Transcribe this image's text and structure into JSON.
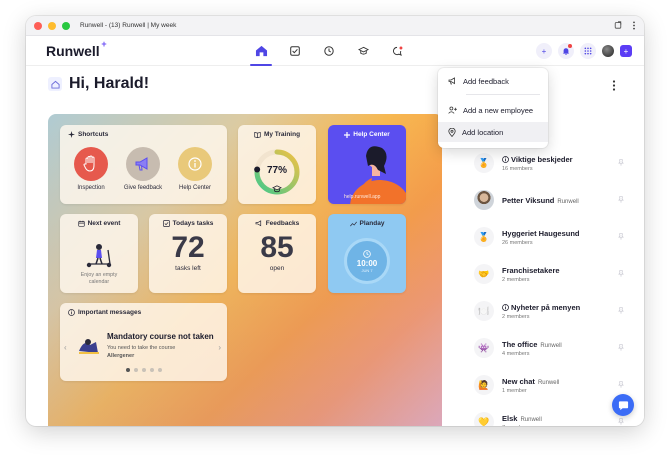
{
  "window": {
    "title": "Runwell - (13) Runwell | My week"
  },
  "app": {
    "logo": "Runwell",
    "logo_spark": "+",
    "plus_glyph": "+"
  },
  "greeting": "Hi, Harald!",
  "shortcuts": {
    "title": "Shortcuts",
    "items": [
      {
        "label": "Inspection",
        "icon": "stop-hand-icon"
      },
      {
        "label": "Give feedback",
        "icon": "megaphone-icon"
      },
      {
        "label": "Help Center",
        "icon": "info-icon"
      }
    ]
  },
  "my_training": {
    "title": "My Training",
    "percent_label": "77%",
    "progress": 0.77
  },
  "help_center": {
    "title": "Help Center",
    "url": "help.runwell.app"
  },
  "next_event": {
    "title": "Next event",
    "empty_text": "Enjoy an empty calendar"
  },
  "todays_tasks": {
    "title": "Todays tasks",
    "count": "72",
    "sub": "tasks left"
  },
  "feedbacks": {
    "title": "Feedbacks",
    "count": "85",
    "sub": "open"
  },
  "planday": {
    "title": "Planday",
    "time": "10:00",
    "date": "JUN 7"
  },
  "important_messages": {
    "title": "Important messages",
    "headline": "Mandatory course not taken",
    "body": "You need to take the course",
    "course": "Allergener",
    "dots": 5,
    "active_dot": 0
  },
  "menu": {
    "items": [
      {
        "label": "Add feedback",
        "icon": "megaphone-icon"
      },
      {
        "label": "Add a new employee",
        "icon": "add-user-icon"
      },
      {
        "label": "Add location",
        "icon": "location-pin-icon"
      }
    ]
  },
  "chats": [
    {
      "name": "Viktige beskjeder",
      "org": "",
      "sub": "16 members",
      "emoji": "🏅",
      "info": true
    },
    {
      "name": "Petter Viksund",
      "org": "Runwell",
      "sub": "",
      "emoji": "",
      "photo": true
    },
    {
      "name": "Hyggeriet Haugesund",
      "org": "",
      "sub": "26 members",
      "emoji": "🏅"
    },
    {
      "name": "Franchisetakere",
      "org": "",
      "sub": "2 members",
      "emoji": "🤝"
    },
    {
      "name": "Nyheter på menyen",
      "org": "",
      "sub": "2 members",
      "emoji": "🍽️",
      "info": true
    },
    {
      "name": "The office",
      "org": "Runwell",
      "sub": "4 members",
      "emoji": "👾"
    },
    {
      "name": "New chat",
      "org": "Runwell",
      "sub": "1 member",
      "emoji": "🙋"
    },
    {
      "name": "Elsk",
      "org": "Runwell",
      "sub": "7 members",
      "emoji": "💛"
    }
  ],
  "colors": {
    "accent": "#4f46e5",
    "help_center_bg": "#5b4ef0",
    "planday_bg": "#8fc9f2",
    "fab": "#3b6cf6"
  }
}
